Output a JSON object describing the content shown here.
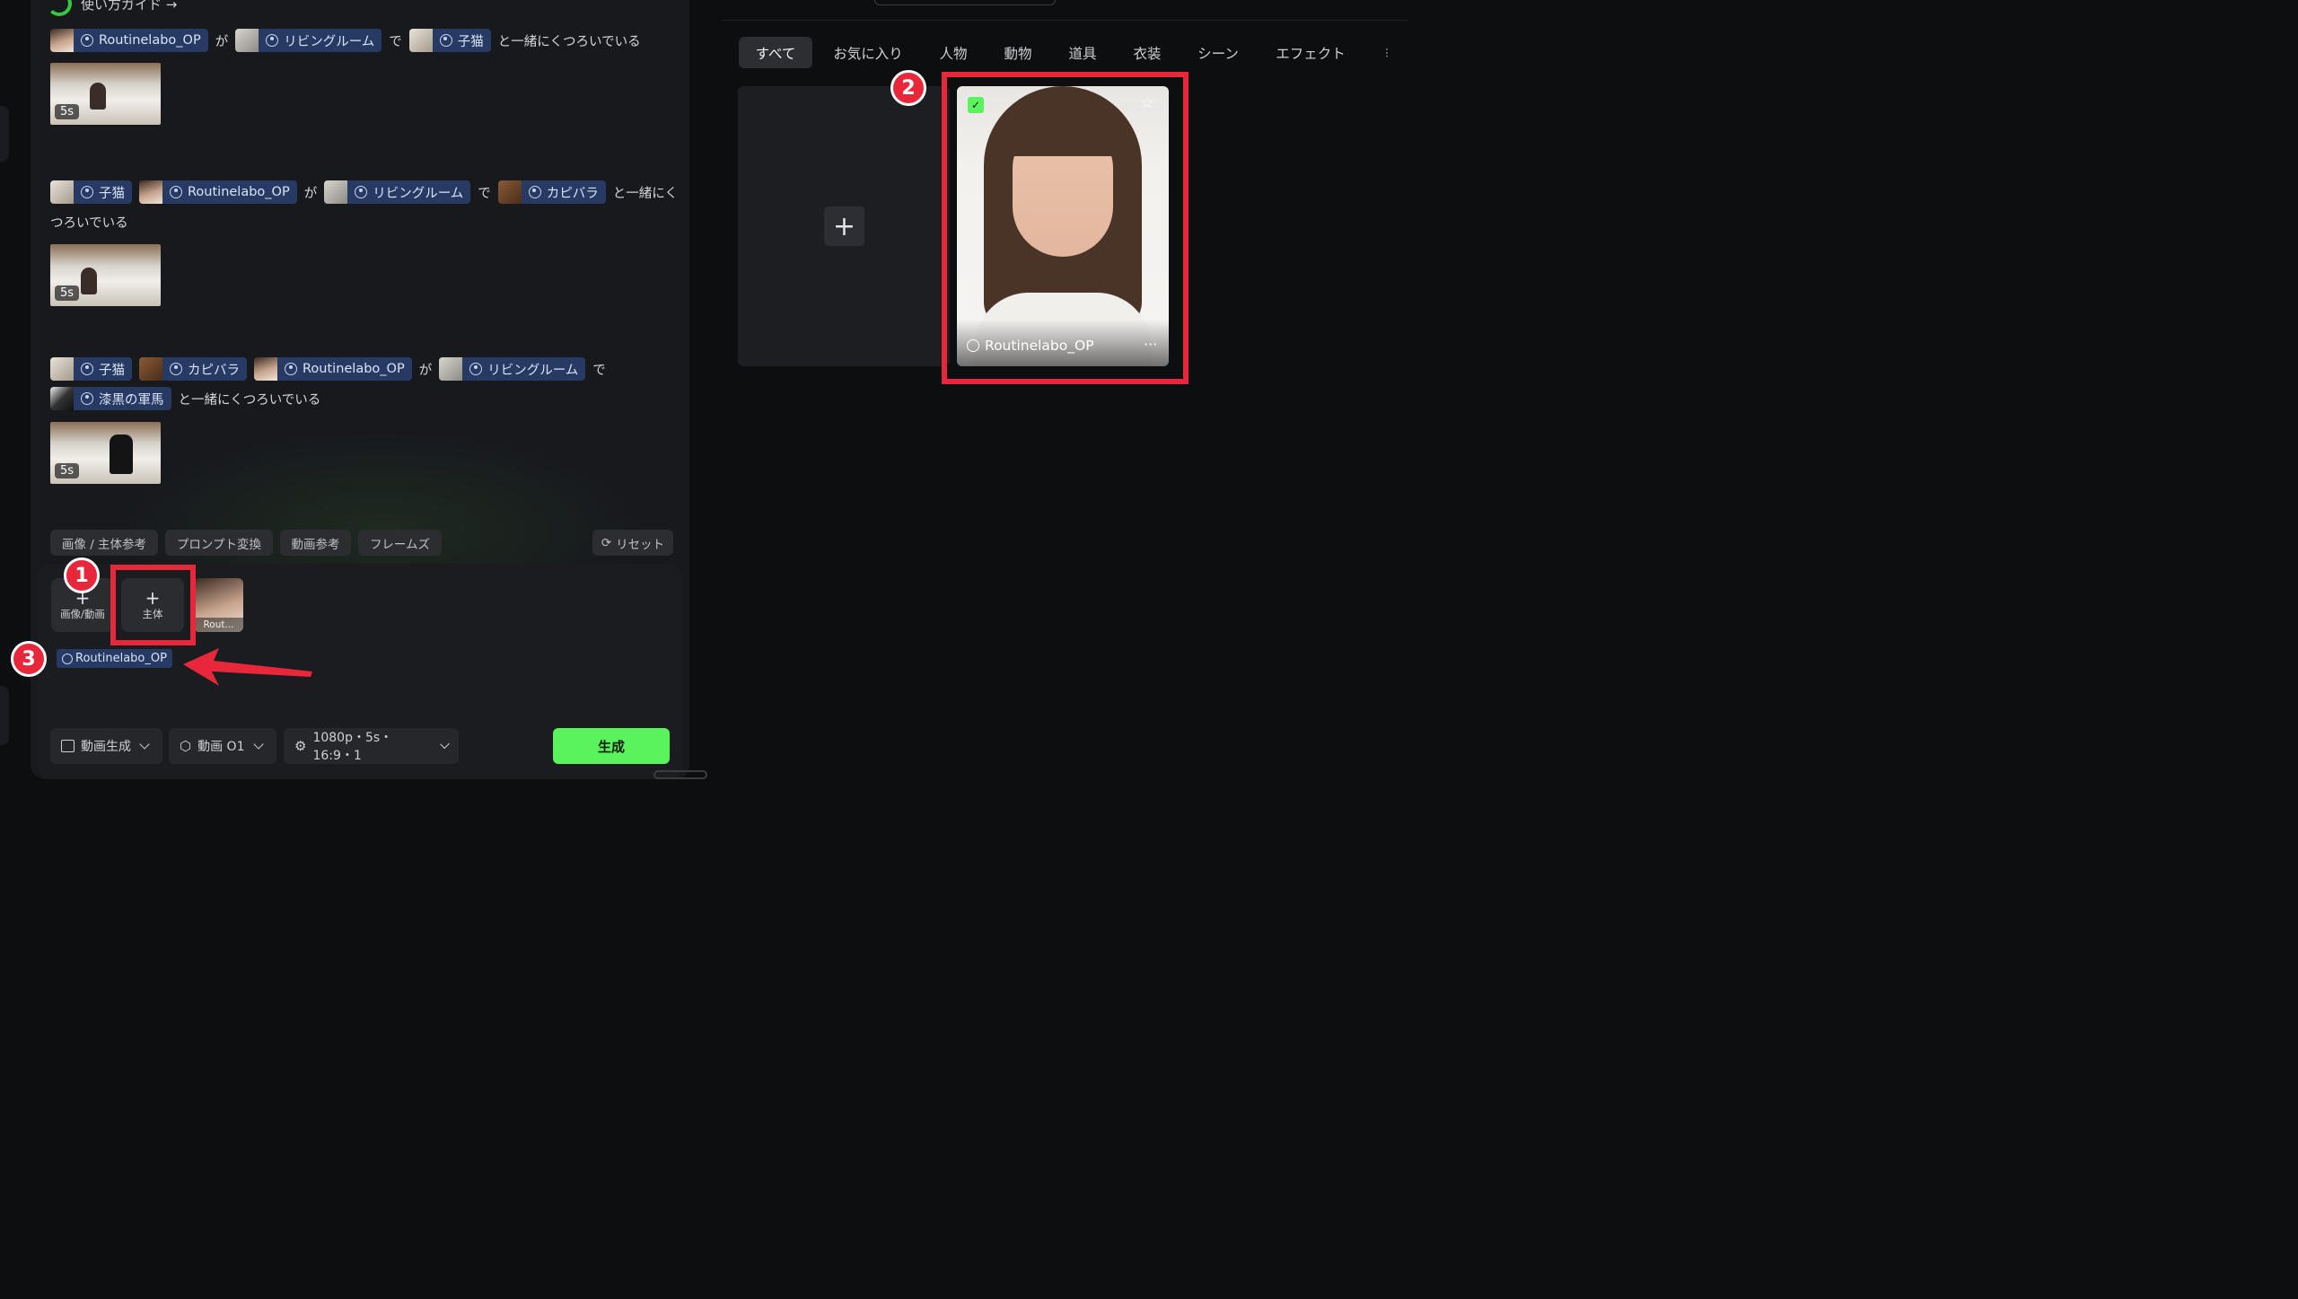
{
  "guide": {
    "label": "使い方ガイド →"
  },
  "prompts": [
    {
      "parts": [
        {
          "type": "chip",
          "label": "Routinelabo_OP",
          "thumb": "girl"
        },
        {
          "type": "text",
          "label": "が"
        },
        {
          "type": "chip",
          "label": "リビングルーム",
          "thumb": "room"
        },
        {
          "type": "text",
          "label": "で"
        },
        {
          "type": "chip",
          "label": "子猫",
          "thumb": "cat"
        },
        {
          "type": "text",
          "label": "と一緒にくつろいでいる"
        }
      ],
      "duration": "5s"
    },
    {
      "parts_line1": [
        {
          "type": "chip",
          "label": "子猫",
          "thumb": "cat"
        },
        {
          "type": "chip",
          "label": "Routinelabo_OP",
          "thumb": "girl"
        },
        {
          "type": "text",
          "label": "が"
        },
        {
          "type": "chip",
          "label": "リビングルーム",
          "thumb": "room"
        },
        {
          "type": "text",
          "label": "で"
        },
        {
          "type": "chip",
          "label": "カピバラ",
          "thumb": "capy"
        },
        {
          "type": "text",
          "label": "と一緒にく"
        }
      ],
      "line2": "つろいでいる",
      "duration": "5s"
    },
    {
      "parts_line1": [
        {
          "type": "chip",
          "label": "子猫",
          "thumb": "cat"
        },
        {
          "type": "chip",
          "label": "カピバラ",
          "thumb": "capy"
        },
        {
          "type": "chip",
          "label": "Routinelabo_OP",
          "thumb": "girl"
        },
        {
          "type": "text",
          "label": "が"
        },
        {
          "type": "chip",
          "label": "リビングルーム",
          "thumb": "room"
        },
        {
          "type": "text",
          "label": "で"
        }
      ],
      "parts_line2": [
        {
          "type": "chip",
          "label": "漆黒の軍馬",
          "thumb": "horse"
        },
        {
          "type": "text",
          "label": "と一緒にくつろいでいる"
        }
      ],
      "duration": "5s"
    }
  ],
  "tools": {
    "image_subject_ref": "画像 / 主体参考",
    "prompt_convert": "プロンプト変換",
    "video_ref": "動画参考",
    "frames": "フレームズ",
    "reset": "リセット"
  },
  "input": {
    "add_media_label": "画像/動画",
    "add_subject_label": "主体",
    "selected_thumb_label": "Rout...",
    "subject_chip": "Routinelabo_OP"
  },
  "bottom": {
    "mode": "動画生成",
    "model": "動画 O1",
    "settings": "1080p・5s・16:9・1",
    "generate": "生成"
  },
  "annotations": {
    "n1": "1",
    "n2": "2",
    "n3": "3"
  },
  "library": {
    "tabs": [
      "すべて",
      "お気に入り",
      "人物",
      "動物",
      "道具",
      "衣装",
      "シーン",
      "エフェクト"
    ],
    "active_tab": "すべて",
    "add_symbol": "+",
    "card": {
      "name": "Routinelabo_OP",
      "more": "···"
    }
  },
  "colors": {
    "accent_green": "#5bf35d",
    "chip_blue": "#263a63",
    "highlight_red": "#e8283a"
  }
}
